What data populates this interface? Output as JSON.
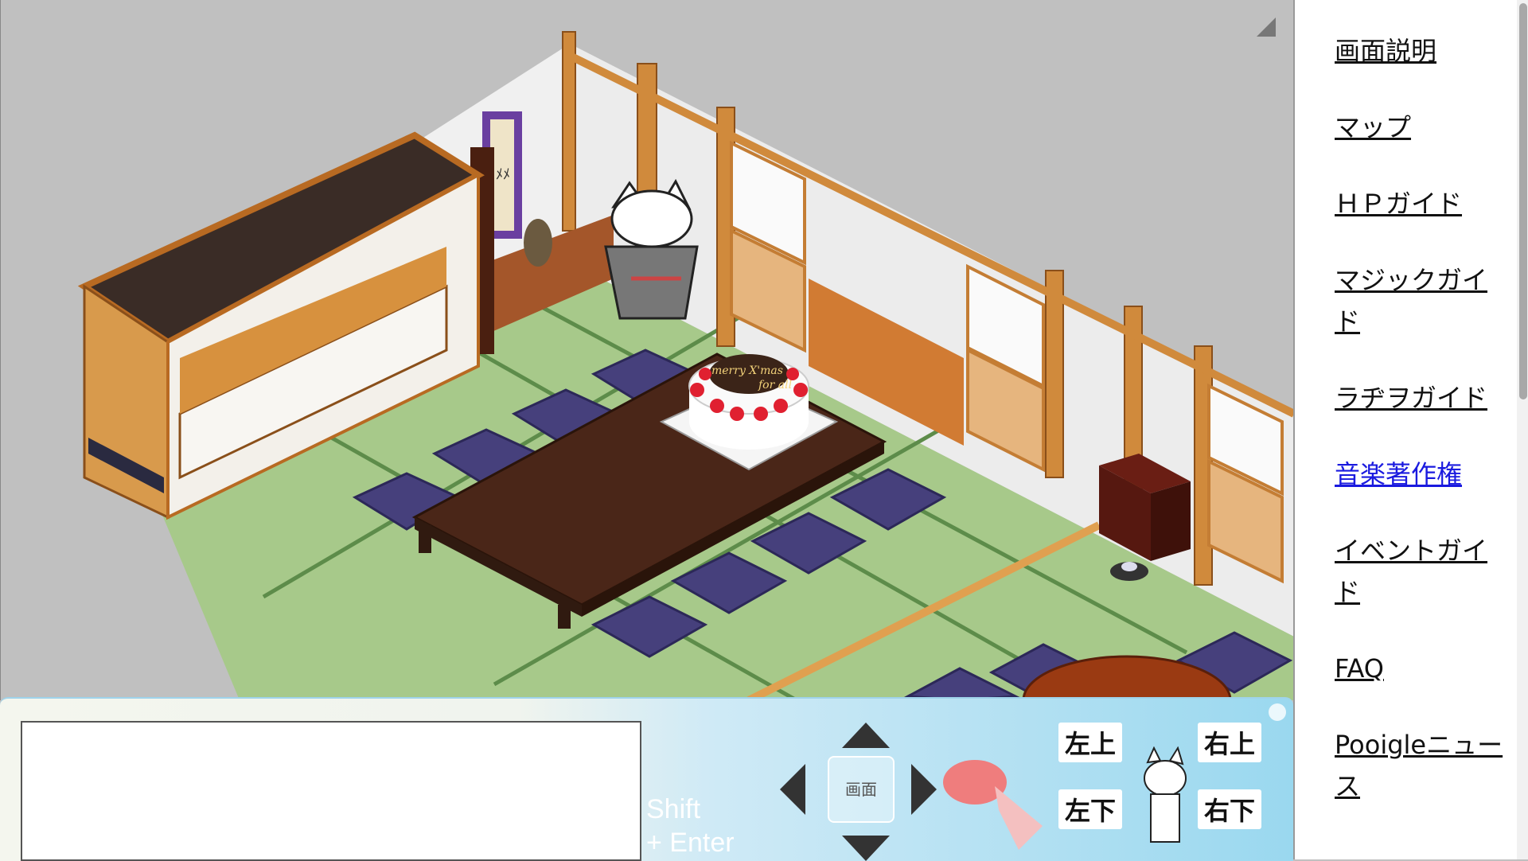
{
  "sidebar": {
    "items": [
      {
        "label": "画面説明"
      },
      {
        "label": "マップ"
      },
      {
        "label": "ＨＰガイド"
      },
      {
        "label": "マジックガイド"
      },
      {
        "label": "ラヂヲガイド"
      },
      {
        "label": "音楽著作権",
        "active": true
      },
      {
        "label": "イベントガイド"
      },
      {
        "label": "FAQ"
      },
      {
        "label": "Pooigleニュース"
      }
    ]
  },
  "scene": {
    "cake_text_line1": "merry X'mas",
    "cake_text_line2": "for all",
    "scroll_char": "ﾒﾒ"
  },
  "chatbar": {
    "input_value": "",
    "shift_hint_line1": "Shift",
    "shift_hint_line2": "+ Enter",
    "screen_button": "画面",
    "dir_upper_left": "左上",
    "dir_upper_right": "右上",
    "dir_lower_left": "左下",
    "dir_lower_right": "右下"
  },
  "colors": {
    "tatami": "#a7c98a",
    "cushion": "#46407c",
    "table": "#4a2618",
    "wood": "#d08a3c",
    "link_active": "#1a1adf"
  }
}
